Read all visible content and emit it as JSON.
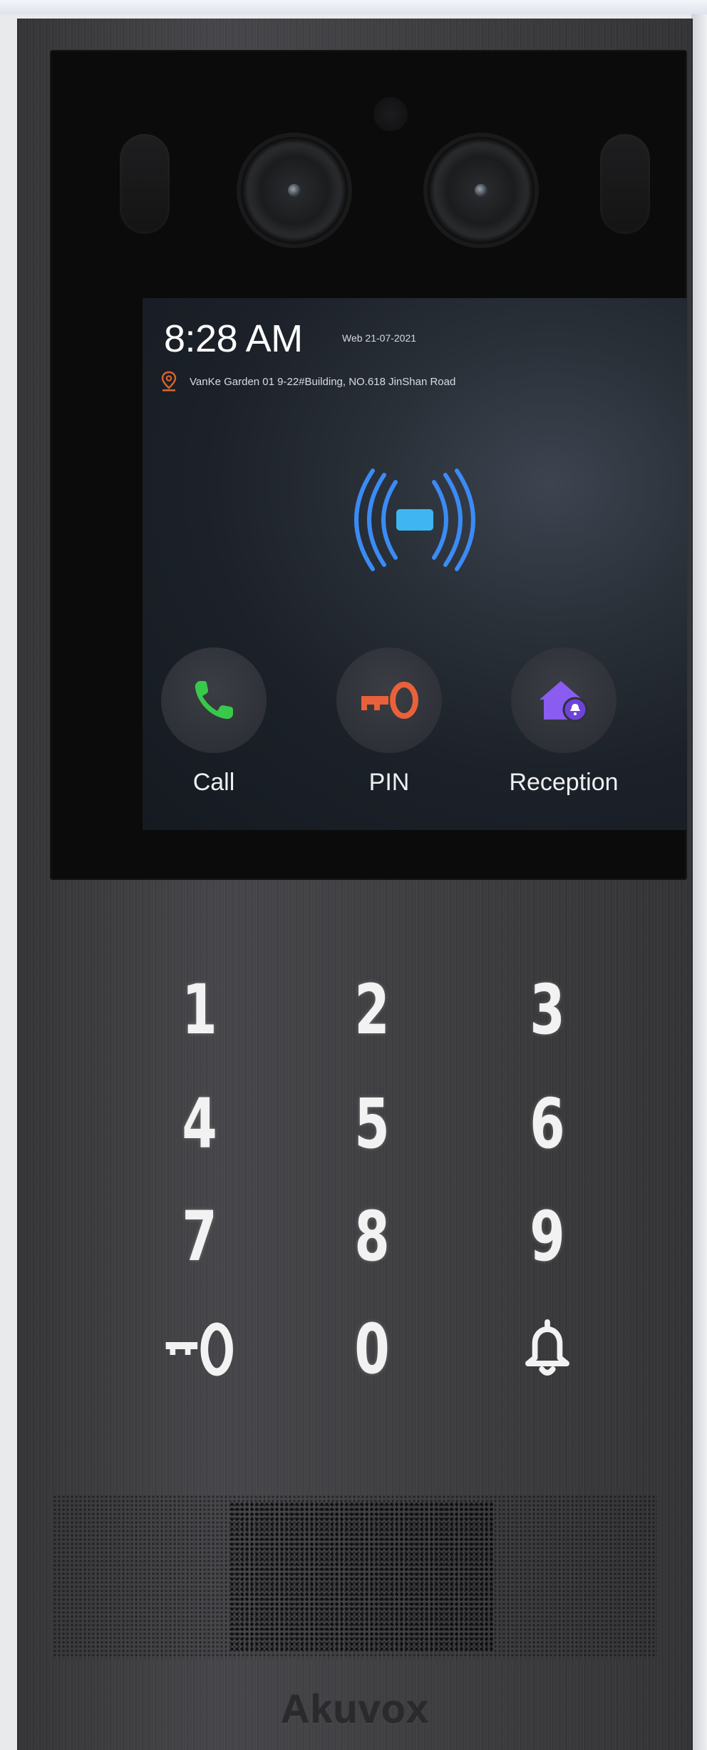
{
  "screen": {
    "time": "8:28 AM",
    "date": "Web 21-07-2021",
    "address": "VanKe Garden 01 9-22#Building, NO.618 JinShan Road"
  },
  "actions": [
    {
      "label": "Call",
      "icon": "phone-icon",
      "color": "#39c94a"
    },
    {
      "label": "PIN",
      "icon": "key-icon",
      "color": "#e8613a"
    },
    {
      "label": "Reception",
      "icon": "reception-house-icon",
      "color": "#8a5cf0"
    }
  ],
  "nfc": {
    "icon": "nfc-card-icon",
    "color": "#3b8bf5"
  },
  "keypad": {
    "keys": [
      "1",
      "2",
      "3",
      "4",
      "5",
      "6",
      "7",
      "8",
      "9",
      "",
      "0",
      ""
    ],
    "key_icons": {
      "bottom_left": "key-icon",
      "bottom_right": "bell-icon"
    }
  },
  "brand": "Akuvox"
}
